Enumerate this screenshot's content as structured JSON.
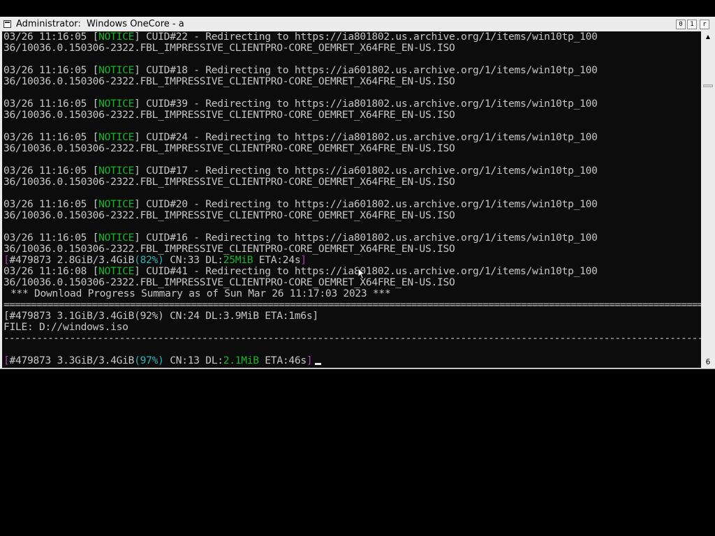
{
  "window": {
    "title": "Administrator:  Windows OneCore - a",
    "controls": {
      "minimize": "0",
      "maximize": "1",
      "close": "r"
    }
  },
  "scrollbar": {
    "up_arrow": "▲",
    "down_arrow": "6"
  },
  "console": {
    "lines": [
      {
        "kind": "text",
        "runs": [
          [
            "03/26 11:16:05 [",
            "w"
          ],
          [
            "NOTICE",
            "g"
          ],
          [
            "] CUID#22 - Redirecting to https://ia801802.us.archive.org/1/items/win10tp_100",
            "w"
          ]
        ]
      },
      {
        "kind": "text",
        "runs": [
          [
            "36/10036.0.150306-2322.FBL_IMPRESSIVE_CLIENTPRO-CORE_OEMRET_X64FRE_EN-US.ISO",
            "w"
          ]
        ]
      },
      {
        "kind": "blank",
        "runs": []
      },
      {
        "kind": "text",
        "runs": [
          [
            "03/26 11:16:05 [",
            "w"
          ],
          [
            "NOTICE",
            "g"
          ],
          [
            "] CUID#18 - Redirecting to https://ia601802.us.archive.org/1/items/win10tp_100",
            "w"
          ]
        ]
      },
      {
        "kind": "text",
        "runs": [
          [
            "36/10036.0.150306-2322.FBL_IMPRESSIVE_CLIENTPRO-CORE_OEMRET_X64FRE_EN-US.ISO",
            "w"
          ]
        ]
      },
      {
        "kind": "blank",
        "runs": []
      },
      {
        "kind": "text",
        "runs": [
          [
            "03/26 11:16:05 [",
            "w"
          ],
          [
            "NOTICE",
            "g"
          ],
          [
            "] CUID#39 - Redirecting to https://ia801802.us.archive.org/1/items/win10tp_100",
            "w"
          ]
        ]
      },
      {
        "kind": "text",
        "runs": [
          [
            "36/10036.0.150306-2322.FBL_IMPRESSIVE_CLIENTPRO-CORE_OEMRET_X64FRE_EN-US.ISO",
            "w"
          ]
        ]
      },
      {
        "kind": "blank",
        "runs": []
      },
      {
        "kind": "text",
        "runs": [
          [
            "03/26 11:16:05 [",
            "w"
          ],
          [
            "NOTICE",
            "g"
          ],
          [
            "] CUID#24 - Redirecting to https://ia801802.us.archive.org/1/items/win10tp_100",
            "w"
          ]
        ]
      },
      {
        "kind": "text",
        "runs": [
          [
            "36/10036.0.150306-2322.FBL_IMPRESSIVE_CLIENTPRO-CORE_OEMRET_X64FRE_EN-US.ISO",
            "w"
          ]
        ]
      },
      {
        "kind": "blank",
        "runs": []
      },
      {
        "kind": "text",
        "runs": [
          [
            "03/26 11:16:05 [",
            "w"
          ],
          [
            "NOTICE",
            "g"
          ],
          [
            "] CUID#17 - Redirecting to https://ia601802.us.archive.org/1/items/win10tp_100",
            "w"
          ]
        ]
      },
      {
        "kind": "text",
        "runs": [
          [
            "36/10036.0.150306-2322.FBL_IMPRESSIVE_CLIENTPRO-CORE_OEMRET_X64FRE_EN-US.ISO",
            "w"
          ]
        ]
      },
      {
        "kind": "blank",
        "runs": []
      },
      {
        "kind": "text",
        "runs": [
          [
            "03/26 11:16:05 [",
            "w"
          ],
          [
            "NOTICE",
            "g"
          ],
          [
            "] CUID#20 - Redirecting to https://ia601802.us.archive.org/1/items/win10tp_100",
            "w"
          ]
        ]
      },
      {
        "kind": "text",
        "runs": [
          [
            "36/10036.0.150306-2322.FBL_IMPRESSIVE_CLIENTPRO-CORE_OEMRET_X64FRE_EN-US.ISO",
            "w"
          ]
        ]
      },
      {
        "kind": "blank",
        "runs": []
      },
      {
        "kind": "text",
        "runs": [
          [
            "03/26 11:16:05 [",
            "w"
          ],
          [
            "NOTICE",
            "g"
          ],
          [
            "] CUID#16 - Redirecting to https://ia801802.us.archive.org/1/items/win10tp_100",
            "w"
          ]
        ]
      },
      {
        "kind": "text",
        "runs": [
          [
            "36/10036.0.150306-2322.FBL_IMPRESSIVE_CLIENTPRO-CORE_OEMRET_X64FRE_EN-US.ISO",
            "w"
          ]
        ]
      },
      {
        "kind": "progress",
        "runs": [
          [
            "[",
            "m"
          ],
          [
            "#479873 2.8GiB/3.4GiB",
            "w"
          ],
          [
            "(82%)",
            "c"
          ],
          [
            " CN:33 DL:",
            "w"
          ],
          [
            "25MiB",
            "g"
          ],
          [
            " ETA:24s",
            "w"
          ],
          [
            "]",
            "m"
          ]
        ]
      },
      {
        "kind": "text",
        "runs": [
          [
            "03/26 11:16:08 [",
            "w"
          ],
          [
            "NOTICE",
            "g"
          ],
          [
            "] CUID#41 - Redirecting to https://ia801802.us.archive.org/1/items/win10tp_100",
            "w"
          ]
        ]
      },
      {
        "kind": "text",
        "runs": [
          [
            "36/10036.0.150306-2322.FBL_IMPRESSIVE_CLIENTPRO-CORE_OEMRET_X64FRE_EN-US.ISO",
            "w"
          ]
        ]
      },
      {
        "kind": "title",
        "runs": [
          [
            "*** Download Progress Summary as of Sun Mar 26 11:17:03 2023 ***",
            "w"
          ]
        ]
      },
      {
        "kind": "rule",
        "runs": [
          [
            "================================================================================================================================",
            "w"
          ]
        ]
      },
      {
        "kind": "text",
        "runs": [
          [
            "[#479873 3.1GiB/3.4GiB(92%) CN:24 DL:3.9MiB ETA:1m6s]",
            "w"
          ]
        ]
      },
      {
        "kind": "text",
        "runs": [
          [
            "FILE: D://windows.iso",
            "w"
          ]
        ]
      },
      {
        "kind": "rule",
        "runs": [
          [
            "--------------------------------------------------------------------------------------------------------------------------------",
            "w"
          ]
        ]
      },
      {
        "kind": "blank",
        "runs": []
      },
      {
        "kind": "progress",
        "runs": [
          [
            "[",
            "m"
          ],
          [
            "#479873 3.3GiB/3.4GiB",
            "w"
          ],
          [
            "(97%)",
            "c"
          ],
          [
            " CN:13 DL:",
            "w"
          ],
          [
            "2.1MiB",
            "g"
          ],
          [
            " ETA:46s",
            "w"
          ],
          [
            "]",
            "m"
          ]
        ],
        "cursor": true
      }
    ]
  },
  "pointer": "arrow-cursor",
  "colors": {
    "desktop": "#000000",
    "console_bg": "#0c0c0c",
    "text": "#c6c6c6",
    "green": "#19b629",
    "cyan": "#34b1bb",
    "magenta": "#b13fb1",
    "chrome": "#ececec"
  }
}
